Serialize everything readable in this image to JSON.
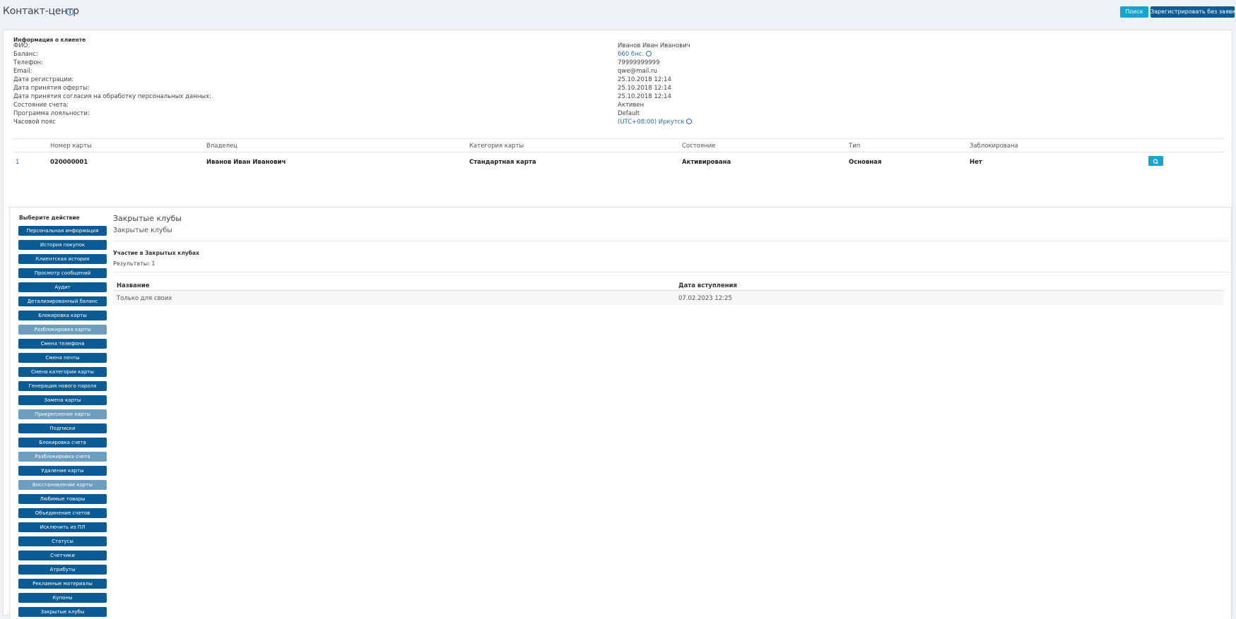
{
  "header": {
    "title": "Контакт-центр",
    "info_icon": "i",
    "search_label": "Поиск",
    "register_label": "Зарегистрировать без заявки"
  },
  "client_info": {
    "section_title": "Информация о клиенте",
    "fields": [
      {
        "label": "ФИО:",
        "value": "Иванов Иван Иванович"
      },
      {
        "label": "Баланс:",
        "value": "660 бнс."
      },
      {
        "label": "Телефон:",
        "value": "79999999999"
      },
      {
        "label": "Email:",
        "value": "qwe@mail.ru"
      },
      {
        "label": "Дата регистрации:",
        "value": "25.10.2018 12:14"
      },
      {
        "label": "Дата принятия оферты:",
        "value": "25.10.2018 12:14"
      },
      {
        "label": "Дата принятия согласия на обработку персональных данных:",
        "value": "25.10.2018 12:14"
      },
      {
        "label": "Состояние счета:",
        "value": "Активен"
      },
      {
        "label": "Программа лояльности:",
        "value": "Default"
      },
      {
        "label": "Часовой пояс",
        "value": "(UTC+08:00) Иркутск"
      }
    ]
  },
  "cards": {
    "headers": [
      "Номер карты",
      "Владелец",
      "Категория карты",
      "Состояние",
      "Тип",
      "Заблокирована"
    ],
    "rows": [
      {
        "index": "1",
        "number": "020000001",
        "owner": "Иванов Иван Иванович",
        "category": "Стандартная карта",
        "state": "Активирована",
        "type": "Основная",
        "blocked": "Нет"
      }
    ]
  },
  "actions": {
    "title": "Выберите действие",
    "items": [
      {
        "label": "Персональная информация",
        "enabled": true
      },
      {
        "label": "История покупок",
        "enabled": true
      },
      {
        "label": "Клиентская история",
        "enabled": true
      },
      {
        "label": "Просмотр сообщений",
        "enabled": true
      },
      {
        "label": "Аудит",
        "enabled": true
      },
      {
        "label": "Детализированный баланс",
        "enabled": true
      },
      {
        "label": "Блокировка карты",
        "enabled": true
      },
      {
        "label": "Разблокировка карты",
        "enabled": false
      },
      {
        "label": "Смена телефона",
        "enabled": true
      },
      {
        "label": "Смена почты",
        "enabled": true
      },
      {
        "label": "Смена категории карты",
        "enabled": true
      },
      {
        "label": "Генерация нового пароля",
        "enabled": true
      },
      {
        "label": "Замена карты",
        "enabled": true
      },
      {
        "label": "Прикрепление карты",
        "enabled": false
      },
      {
        "label": "Подписки",
        "enabled": true
      },
      {
        "label": "Блокировка счета",
        "enabled": true
      },
      {
        "label": "Разблокировка счета",
        "enabled": false
      },
      {
        "label": "Удаление карты",
        "enabled": true
      },
      {
        "label": "Восстановление карты",
        "enabled": false
      },
      {
        "label": "Любимые товары",
        "enabled": true
      },
      {
        "label": "Объединение счетов",
        "enabled": true
      },
      {
        "label": "Исключить из ПЛ",
        "enabled": true
      },
      {
        "label": "Статусы",
        "enabled": true
      },
      {
        "label": "Счетчики",
        "enabled": true
      },
      {
        "label": "Атрибуты",
        "enabled": true
      },
      {
        "label": "Рекламные материалы",
        "enabled": true
      },
      {
        "label": "Купоны",
        "enabled": true
      },
      {
        "label": "Закрытые клубы",
        "enabled": true
      }
    ]
  },
  "closed_clubs": {
    "title": "Закрытые клубы",
    "subtitle": "Закрытые клубы",
    "section_title": "Участие в Закрытых клубах",
    "results": "Результаты: 1",
    "headers": [
      "Название",
      "Дата вступления"
    ],
    "rows": [
      {
        "name": "Только для своих",
        "date": "07.02.2023 12:25"
      }
    ]
  }
}
